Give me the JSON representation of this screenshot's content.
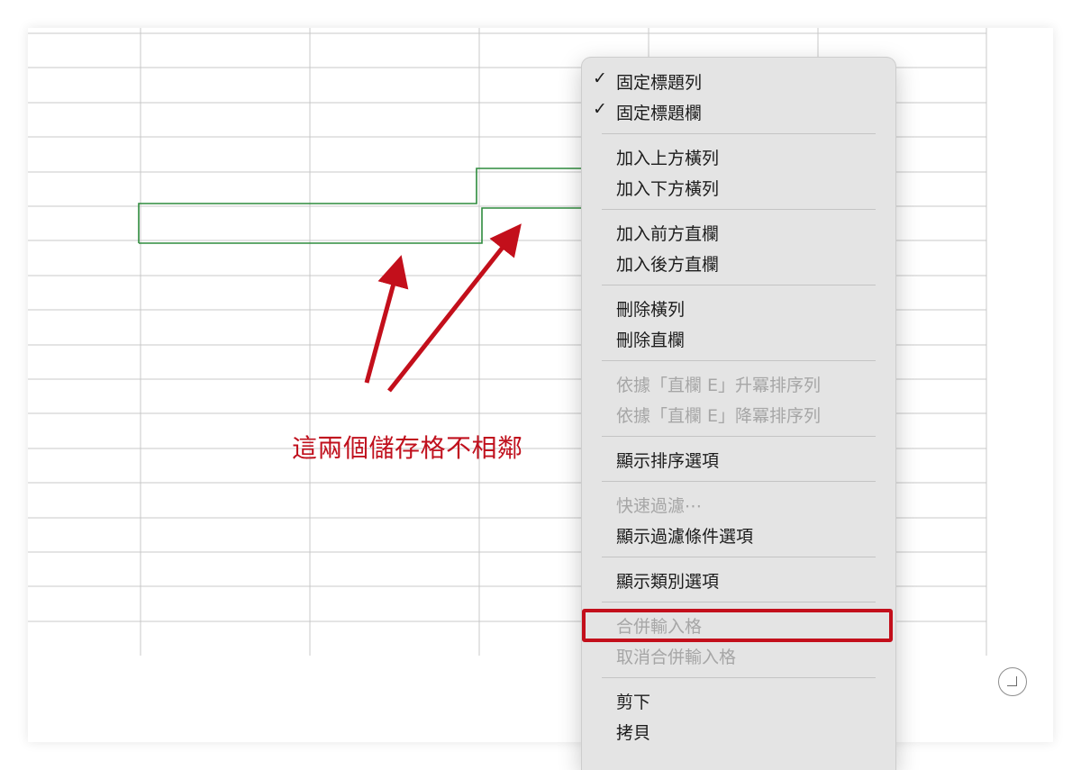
{
  "annotation": {
    "text": "這兩個儲存格不相鄰",
    "color": "#c0101d"
  },
  "spreadsheet": {
    "selection_color": "#2e8b3d",
    "grid_color": "#c9c9c9"
  },
  "context_menu": {
    "items": [
      {
        "label": "固定標題列",
        "checked": true,
        "enabled": true
      },
      {
        "label": "固定標題欄",
        "checked": true,
        "enabled": true
      },
      {
        "separator": true
      },
      {
        "label": "加入上方橫列",
        "enabled": true
      },
      {
        "label": "加入下方橫列",
        "enabled": true
      },
      {
        "separator": true
      },
      {
        "label": "加入前方直欄",
        "enabled": true
      },
      {
        "label": "加入後方直欄",
        "enabled": true
      },
      {
        "separator": true
      },
      {
        "label": "刪除橫列",
        "enabled": true
      },
      {
        "label": "刪除直欄",
        "enabled": true
      },
      {
        "separator": true
      },
      {
        "label": "依據「直欄 E」升冪排序列",
        "enabled": false
      },
      {
        "label": "依據「直欄 E」降冪排序列",
        "enabled": false
      },
      {
        "separator": true
      },
      {
        "label": "顯示排序選項",
        "enabled": true
      },
      {
        "separator": true
      },
      {
        "label": "快速過濾⋯",
        "enabled": false
      },
      {
        "label": "顯示過濾條件選項",
        "enabled": true
      },
      {
        "separator": true
      },
      {
        "label": "顯示類別選項",
        "enabled": true
      },
      {
        "separator": true
      },
      {
        "label": "合併輸入格",
        "enabled": false,
        "highlighted": true
      },
      {
        "label": "取消合併輸入格",
        "enabled": false
      },
      {
        "separator": true
      },
      {
        "label": "剪下",
        "enabled": true
      },
      {
        "label": "拷貝",
        "enabled": true
      }
    ],
    "check_icon": "checkmark-icon",
    "highlight_color": "#c30f1b"
  },
  "icons": {
    "resize_handle": "resize-corner-icon",
    "arrows": "red-arrow-icon"
  }
}
